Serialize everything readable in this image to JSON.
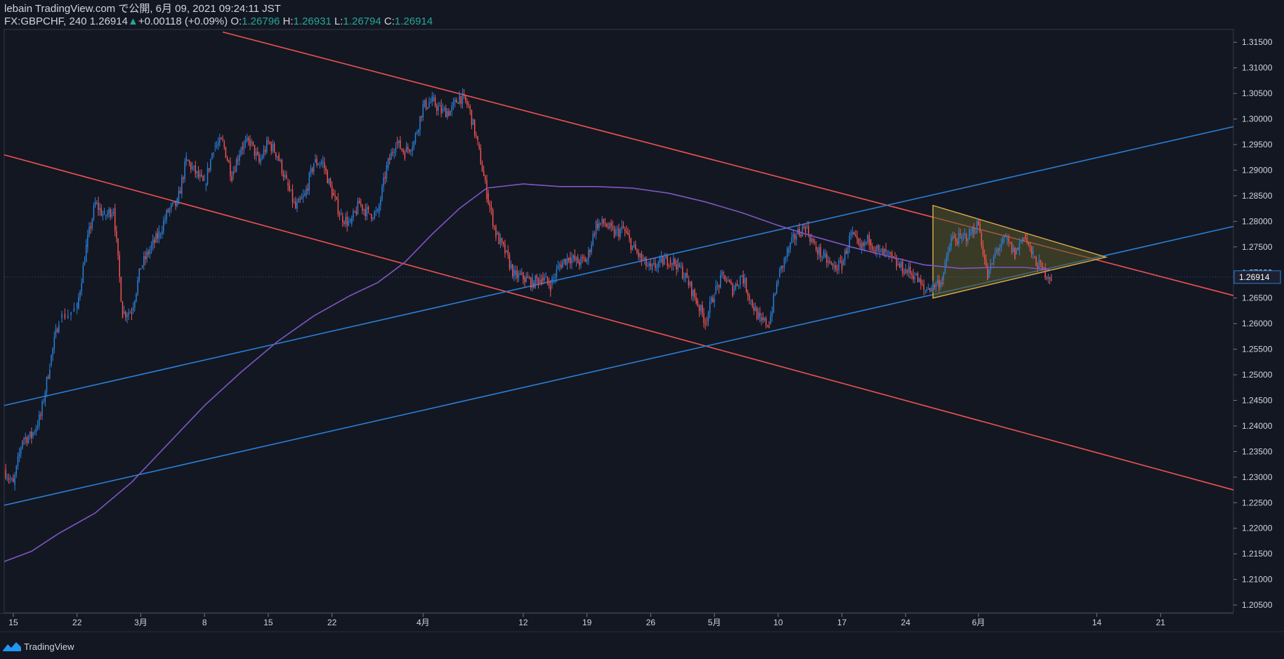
{
  "header": {
    "line1": "lebain TradingView.com で公開, 6月 09, 2021 09:24:11 JST",
    "symbol": "FX:GBPCHF, 240",
    "last": "1.26914",
    "change": "+0.00118 (+0.09%)",
    "o_label": "O:",
    "o_value": "1.26796",
    "h_label": "H:",
    "h_value": "1.26931",
    "l_label": "L:",
    "l_value": "1.26794",
    "c_label": "C:",
    "c_value": "1.26914"
  },
  "footer": {
    "brand": "TradingView",
    "logo_icon": "tradingview-logo-icon"
  },
  "colors": {
    "background": "#131722",
    "up": "#2a7fd6",
    "down": "#ef5350",
    "ma": "#7e57c2",
    "triangle_fill": "#5a5a2a"
  },
  "chart_data": {
    "type": "candlestick",
    "symbol": "FX:GBPCHF",
    "interval": "240",
    "ylim": [
      1.2035,
      1.3175
    ],
    "y_ticks": [
      1.205,
      1.21,
      1.215,
      1.22,
      1.225,
      1.23,
      1.235,
      1.24,
      1.245,
      1.25,
      1.255,
      1.26,
      1.265,
      1.27,
      1.275,
      1.28,
      1.285,
      1.29,
      1.295,
      1.3,
      1.305,
      1.31,
      1.315
    ],
    "y_tick_labels": [
      "1.20500",
      "1.21000",
      "1.21500",
      "1.22000",
      "1.22500",
      "1.23000",
      "1.23500",
      "1.24000",
      "1.24500",
      "1.25000",
      "1.25500",
      "1.26000",
      "1.26500",
      "1.27000",
      "1.27500",
      "1.28000",
      "1.28500",
      "1.29000",
      "1.29500",
      "1.30000",
      "1.30500",
      "1.31000",
      "1.31500"
    ],
    "current_price_label": "1.26914",
    "x_range": [
      "2021-02-14",
      "2021-06-29"
    ],
    "x_ticks": [
      {
        "date": "2021-02-15",
        "label": "15"
      },
      {
        "date": "2021-02-22",
        "label": "22"
      },
      {
        "date": "2021-03-01",
        "label": "3月"
      },
      {
        "date": "2021-03-08",
        "label": "8"
      },
      {
        "date": "2021-03-15",
        "label": "15"
      },
      {
        "date": "2021-03-22",
        "label": "22"
      },
      {
        "date": "2021-04-01",
        "label": "4月"
      },
      {
        "date": "2021-04-12",
        "label": "12"
      },
      {
        "date": "2021-04-19",
        "label": "19"
      },
      {
        "date": "2021-04-26",
        "label": "26"
      },
      {
        "date": "2021-05-03",
        "label": "5月"
      },
      {
        "date": "2021-05-10",
        "label": "10"
      },
      {
        "date": "2021-05-17",
        "label": "17"
      },
      {
        "date": "2021-05-24",
        "label": "24"
      },
      {
        "date": "2021-06-01",
        "label": "6月"
      },
      {
        "date": "2021-06-14",
        "label": "14"
      },
      {
        "date": "2021-06-21",
        "label": "21"
      }
    ],
    "price_path": [
      [
        "2021-02-14",
        1.2315
      ],
      [
        "2021-02-15",
        1.2285
      ],
      [
        "2021-02-16",
        1.2375
      ],
      [
        "2021-02-17",
        1.238
      ],
      [
        "2021-02-18",
        1.242
      ],
      [
        "2021-02-19",
        1.252
      ],
      [
        "2021-02-20",
        1.261
      ],
      [
        "2021-02-22",
        1.263
      ],
      [
        "2021-02-23",
        1.275
      ],
      [
        "2021-02-24",
        1.2835
      ],
      [
        "2021-02-25",
        1.281
      ],
      [
        "2021-02-26",
        1.2825
      ],
      [
        "2021-02-27",
        1.262
      ],
      [
        "2021-02-28",
        1.2625
      ],
      [
        "2021-03-01",
        1.271
      ],
      [
        "2021-03-02",
        1.2745
      ],
      [
        "2021-03-03",
        1.2775
      ],
      [
        "2021-03-04",
        1.282
      ],
      [
        "2021-03-05",
        1.2835
      ],
      [
        "2021-03-06",
        1.292
      ],
      [
        "2021-03-07",
        1.2895
      ],
      [
        "2021-03-08",
        1.287
      ],
      [
        "2021-03-09",
        1.2945
      ],
      [
        "2021-03-10",
        1.2955
      ],
      [
        "2021-03-11",
        1.289
      ],
      [
        "2021-03-12",
        1.2945
      ],
      [
        "2021-03-13",
        1.2955
      ],
      [
        "2021-03-14",
        1.2915
      ],
      [
        "2021-03-15",
        1.2955
      ],
      [
        "2021-03-16",
        1.293
      ],
      [
        "2021-03-17",
        1.2875
      ],
      [
        "2021-03-18",
        1.2825
      ],
      [
        "2021-03-19",
        1.285
      ],
      [
        "2021-03-20",
        1.2915
      ],
      [
        "2021-03-21",
        1.2915
      ],
      [
        "2021-03-22",
        1.2855
      ],
      [
        "2021-03-23",
        1.281
      ],
      [
        "2021-03-24",
        1.2795
      ],
      [
        "2021-03-25",
        1.2835
      ],
      [
        "2021-03-26",
        1.2815
      ],
      [
        "2021-03-27",
        1.2815
      ],
      [
        "2021-03-28",
        1.2905
      ],
      [
        "2021-03-29",
        1.2955
      ],
      [
        "2021-03-30",
        1.2935
      ],
      [
        "2021-03-31",
        1.2955
      ],
      [
        "2021-04-01",
        1.3025
      ],
      [
        "2021-04-02",
        1.3035
      ],
      [
        "2021-04-03",
        1.3015
      ],
      [
        "2021-04-04",
        1.3015
      ],
      [
        "2021-04-05",
        1.3045
      ],
      [
        "2021-04-06",
        1.3025
      ],
      [
        "2021-04-07",
        1.295
      ],
      [
        "2021-04-08",
        1.2855
      ],
      [
        "2021-04-09",
        1.2775
      ],
      [
        "2021-04-10",
        1.274
      ],
      [
        "2021-04-11",
        1.2695
      ],
      [
        "2021-04-12",
        1.269
      ],
      [
        "2021-04-13",
        1.268
      ],
      [
        "2021-04-14",
        1.269
      ],
      [
        "2021-04-15",
        1.2675
      ],
      [
        "2021-04-16",
        1.2715
      ],
      [
        "2021-04-17",
        1.273
      ],
      [
        "2021-04-18",
        1.272
      ],
      [
        "2021-04-19",
        1.2725
      ],
      [
        "2021-04-20",
        1.2795
      ],
      [
        "2021-04-21",
        1.2795
      ],
      [
        "2021-04-22",
        1.2775
      ],
      [
        "2021-04-23",
        1.2785
      ],
      [
        "2021-04-24",
        1.275
      ],
      [
        "2021-04-25",
        1.2725
      ],
      [
        "2021-04-26",
        1.2705
      ],
      [
        "2021-04-27",
        1.272
      ],
      [
        "2021-04-28",
        1.2725
      ],
      [
        "2021-04-29",
        1.2715
      ],
      [
        "2021-04-30",
        1.2685
      ],
      [
        "2021-05-01",
        1.2645
      ],
      [
        "2021-05-02",
        1.2605
      ],
      [
        "2021-05-03",
        1.266
      ],
      [
        "2021-05-04",
        1.2695
      ],
      [
        "2021-05-05",
        1.2665
      ],
      [
        "2021-05-06",
        1.2695
      ],
      [
        "2021-05-07",
        1.2645
      ],
      [
        "2021-05-08",
        1.2605
      ],
      [
        "2021-05-09",
        1.26
      ],
      [
        "2021-05-10",
        1.269
      ],
      [
        "2021-05-11",
        1.274
      ],
      [
        "2021-05-12",
        1.2775
      ],
      [
        "2021-05-13",
        1.279
      ],
      [
        "2021-05-14",
        1.275
      ],
      [
        "2021-05-15",
        1.273
      ],
      [
        "2021-05-16",
        1.271
      ],
      [
        "2021-05-17",
        1.2715
      ],
      [
        "2021-05-18",
        1.2775
      ],
      [
        "2021-05-19",
        1.2745
      ],
      [
        "2021-05-20",
        1.2765
      ],
      [
        "2021-05-21",
        1.274
      ],
      [
        "2021-05-22",
        1.2735
      ],
      [
        "2021-05-23",
        1.2715
      ],
      [
        "2021-05-24",
        1.2705
      ],
      [
        "2021-05-25",
        1.2695
      ],
      [
        "2021-05-26",
        1.2665
      ],
      [
        "2021-05-27",
        1.2675
      ],
      [
        "2021-05-28",
        1.2685
      ],
      [
        "2021-05-29",
        1.2765
      ],
      [
        "2021-05-30",
        1.2765
      ],
      [
        "2021-05-31",
        1.2775
      ],
      [
        "2021-06-01",
        1.2795
      ],
      [
        "2021-06-02",
        1.269
      ],
      [
        "2021-06-03",
        1.2745
      ],
      [
        "2021-06-04",
        1.2765
      ],
      [
        "2021-06-05",
        1.2735
      ],
      [
        "2021-06-06",
        1.2775
      ],
      [
        "2021-06-07",
        1.273
      ],
      [
        "2021-06-08",
        1.2705
      ],
      [
        "2021-06-09",
        1.2691
      ]
    ],
    "moving_average": [
      [
        "2021-02-14",
        1.2135
      ],
      [
        "2021-02-17",
        1.2155
      ],
      [
        "2021-02-20",
        1.219
      ],
      [
        "2021-02-24",
        1.223
      ],
      [
        "2021-02-28",
        1.229
      ],
      [
        "2021-03-04",
        1.2365
      ],
      [
        "2021-03-08",
        1.244
      ],
      [
        "2021-03-12",
        1.2505
      ],
      [
        "2021-03-16",
        1.2565
      ],
      [
        "2021-03-20",
        1.2615
      ],
      [
        "2021-03-24",
        1.2655
      ],
      [
        "2021-03-27",
        1.268
      ],
      [
        "2021-03-30",
        1.272
      ],
      [
        "2021-04-02",
        1.2775
      ],
      [
        "2021-04-05",
        1.2825
      ],
      [
        "2021-04-08",
        1.2865
      ],
      [
        "2021-04-12",
        1.2873
      ],
      [
        "2021-04-16",
        1.2868
      ],
      [
        "2021-04-20",
        1.2868
      ],
      [
        "2021-04-24",
        1.2865
      ],
      [
        "2021-04-28",
        1.2855
      ],
      [
        "2021-05-02",
        1.2838
      ],
      [
        "2021-05-06",
        1.2817
      ],
      [
        "2021-05-10",
        1.2792
      ],
      [
        "2021-05-14",
        1.277
      ],
      [
        "2021-05-18",
        1.275
      ],
      [
        "2021-05-22",
        1.2732
      ],
      [
        "2021-05-26",
        1.2715
      ],
      [
        "2021-05-30",
        1.2708
      ],
      [
        "2021-06-03",
        1.271
      ],
      [
        "2021-06-06",
        1.271
      ],
      [
        "2021-06-09",
        1.2705
      ]
    ],
    "trendlines": [
      {
        "color": "#ef5350",
        "from": [
          "2021-02-14",
          1.293
        ],
        "to": [
          "2021-06-29",
          1.2275
        ]
      },
      {
        "color": "#ef5350",
        "from": [
          "2021-03-10",
          1.317
        ],
        "to": [
          "2021-06-29",
          1.2655
        ]
      },
      {
        "color": "#2a7fd6",
        "from": [
          "2021-02-14",
          1.244
        ],
        "to": [
          "2021-06-29",
          1.2985
        ]
      },
      {
        "color": "#2a7fd6",
        "from": [
          "2021-02-14",
          1.2245
        ],
        "to": [
          "2021-06-29",
          1.279
        ]
      }
    ],
    "triangle": {
      "color": "#e0b04a",
      "points": [
        [
          "2021-05-27",
          1.2831
        ],
        [
          "2021-05-27",
          1.265
        ],
        [
          "2021-06-15",
          1.273
        ]
      ]
    }
  }
}
